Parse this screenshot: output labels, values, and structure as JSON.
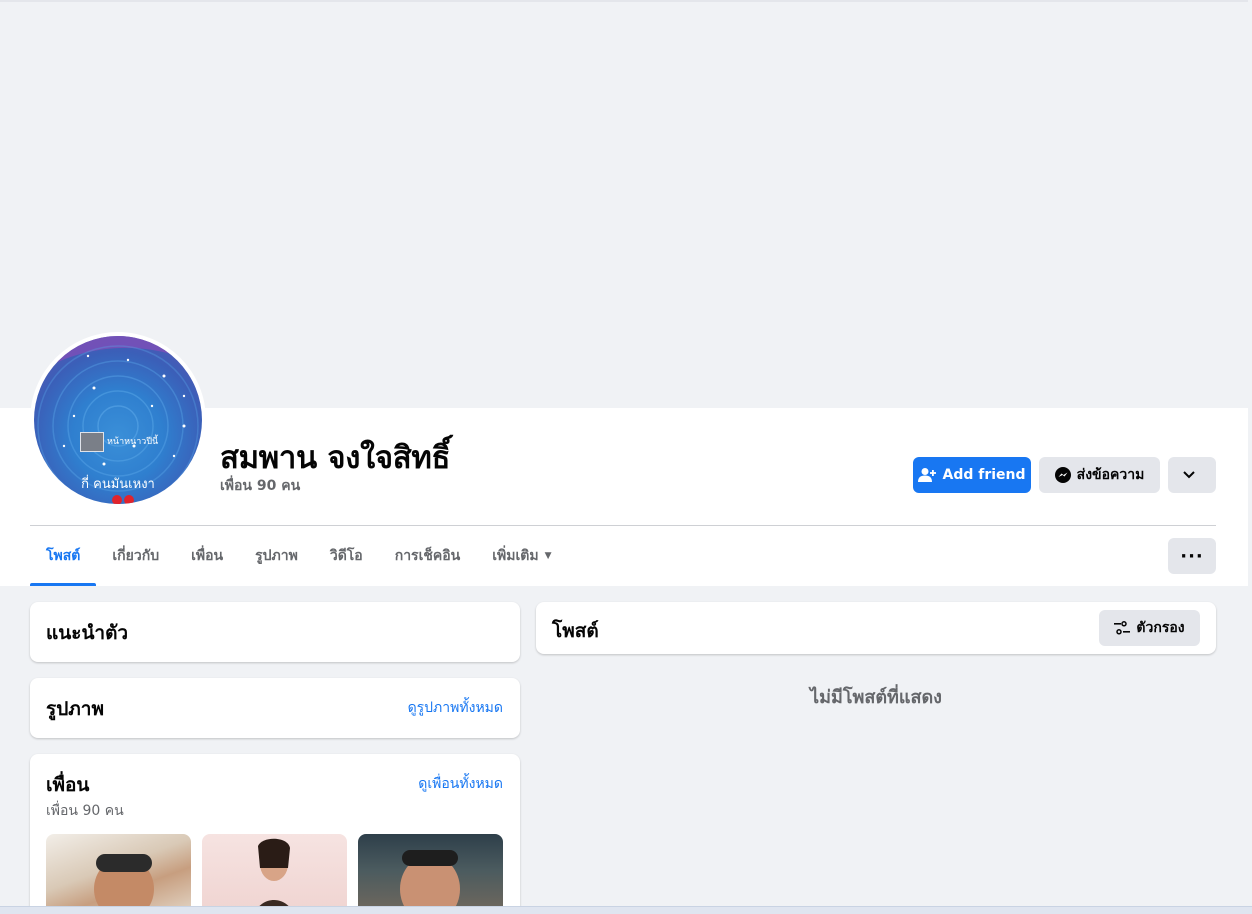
{
  "profile": {
    "name": "สมพาน จงใจสิทธิ์",
    "friend_count_text": "เพื่อน 90 คน",
    "avatar_caption": "กี่ คนมันเหงา",
    "avatar_mini_text": "หน้าหนาวปีนี้"
  },
  "actions": {
    "add_friend": "Add friend",
    "message": "ส่งข้อความ",
    "more_dots": "···"
  },
  "tabs": [
    {
      "label": "โพสต์",
      "active": true
    },
    {
      "label": "เกี่ยวกับ",
      "active": false
    },
    {
      "label": "เพื่อน",
      "active": false
    },
    {
      "label": "รูปภาพ",
      "active": false
    },
    {
      "label": "วิดีโอ",
      "active": false
    },
    {
      "label": "การเช็คอิน",
      "active": false
    },
    {
      "label": "เพิ่มเติม",
      "active": false
    }
  ],
  "intro": {
    "title": "แนะนำตัว"
  },
  "photos": {
    "title": "รูปภาพ",
    "link": "ดูรูปภาพทั้งหมด"
  },
  "friends": {
    "title": "เพื่อน",
    "link": "ดูเพื่อนทั้งหมด",
    "count_text": "เพื่อน 90 คน"
  },
  "posts": {
    "title": "โพสต์",
    "filter": "ตัวกรอง",
    "empty_text": "ไม่มีโพสต์ที่แสดง"
  },
  "colors": {
    "accent": "#1877f2",
    "background": "#f0f2f5",
    "secondary_button": "#e4e6eb"
  }
}
